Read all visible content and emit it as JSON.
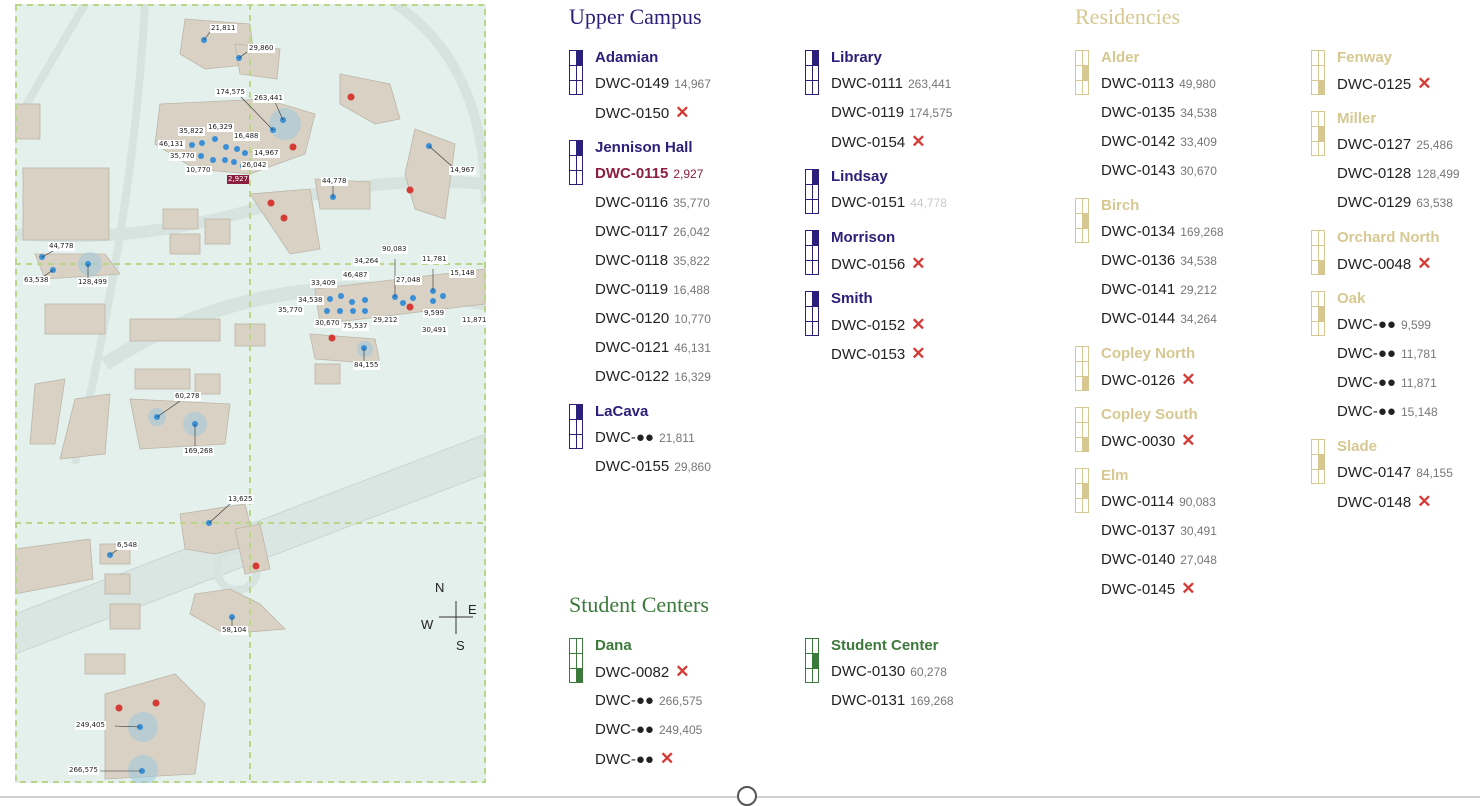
{
  "map": {
    "labels": [
      "21,811",
      "29,860",
      "174,575",
      "263,441",
      "16,329",
      "35,822",
      "16,488",
      "46,131",
      "14,967",
      "35,770",
      "26,042",
      "10,770",
      "2,927",
      "44,778",
      "14,967",
      "44,778",
      "63,538",
      "128,499",
      "90,083",
      "34,264",
      "11,781",
      "15,148",
      "46,487",
      "27,048",
      "33,409",
      "34,538",
      "35,770",
      "30,670",
      "75,537",
      "29,212",
      "9,599",
      "11,871",
      "30,491",
      "84,155",
      "60,278",
      "169,268",
      "13,625",
      "6,548",
      "58,104",
      "249,405",
      "266,575"
    ],
    "compass": {
      "n": "N",
      "e": "E",
      "s": "S",
      "w": "W"
    }
  },
  "colors": {
    "upper": "#2a1f7a",
    "residencies": "#d6c890",
    "student_centers": "#3c7a3b",
    "error": "#d63a35",
    "highlight": "#8b1d3f"
  },
  "sections": {
    "upper": {
      "title": "Upper Campus",
      "col1": [
        {
          "name": "Adamian",
          "level": 0,
          "items": [
            {
              "code": "DWC-0149",
              "count": "14,967"
            },
            {
              "code": "DWC-0150",
              "x": "✕"
            }
          ]
        },
        {
          "name": "Jennison Hall",
          "level": 0,
          "items": [
            {
              "code": "DWC-0115",
              "count": "2,927",
              "highlight": true
            },
            {
              "code": "DWC-0116",
              "count": "35,770"
            },
            {
              "code": "DWC-0117",
              "count": "26,042"
            },
            {
              "code": "DWC-0118",
              "count": "35,822"
            },
            {
              "code": "DWC-0119",
              "count": "16,488"
            },
            {
              "code": "DWC-0120",
              "count": "10,770"
            },
            {
              "code": "DWC-0121",
              "count": "46,131"
            },
            {
              "code": "DWC-0122",
              "count": "16,329"
            }
          ]
        },
        {
          "name": "LaCava",
          "level": 0,
          "items": [
            {
              "code": "DWC-",
              "dots": "●●",
              "count": "21,811"
            },
            {
              "code": "DWC-0155",
              "count": "29,860"
            }
          ]
        }
      ],
      "col2": [
        {
          "name": "Library",
          "level": 0,
          "items": [
            {
              "code": "DWC-0111",
              "count": "263,441"
            },
            {
              "code": "DWC-0119",
              "count": "174,575"
            },
            {
              "code": "DWC-0154",
              "x": "✕"
            }
          ]
        },
        {
          "name": "Lindsay",
          "level": 0,
          "items": [
            {
              "code": "DWC-0151",
              "count": "44,778",
              "faint": true
            }
          ]
        },
        {
          "name": "Morrison",
          "level": 0,
          "items": [
            {
              "code": "DWC-0156",
              "x": "✕"
            }
          ]
        },
        {
          "name": "Smith",
          "level": 0,
          "items": [
            {
              "code": "DWC-0152",
              "x": "✕"
            },
            {
              "code": "DWC-0153",
              "x": "✕"
            }
          ]
        }
      ]
    },
    "residencies": {
      "title": "Residencies",
      "col1": [
        {
          "name": "Alder",
          "level": 1,
          "items": [
            {
              "code": "DWC-0113",
              "count": "49,980"
            },
            {
              "code": "DWC-0135",
              "count": "34,538"
            },
            {
              "code": "DWC-0142",
              "count": "33,409"
            },
            {
              "code": "DWC-0143",
              "count": "30,670"
            }
          ]
        },
        {
          "name": "Birch",
          "level": 1,
          "items": [
            {
              "code": "DWC-0134",
              "count": "169,268"
            },
            {
              "code": "DWC-0136",
              "count": "34,538"
            },
            {
              "code": "DWC-0141",
              "count": "29,212"
            },
            {
              "code": "DWC-0144",
              "count": "34,264"
            }
          ]
        },
        {
          "name": "Copley North",
          "level": 2,
          "items": [
            {
              "code": "DWC-0126",
              "x": "✕"
            }
          ]
        },
        {
          "name": "Copley South",
          "level": 2,
          "items": [
            {
              "code": "DWC-0030",
              "x": "✕"
            }
          ]
        },
        {
          "name": "Elm",
          "level": 1,
          "items": [
            {
              "code": "DWC-0114",
              "count": "90,083"
            },
            {
              "code": "DWC-0137",
              "count": "30,491"
            },
            {
              "code": "DWC-0140",
              "count": "27,048"
            },
            {
              "code": "DWC-0145",
              "x": "✕"
            }
          ]
        }
      ],
      "col2": [
        {
          "name": "Fenway",
          "level": 2,
          "items": [
            {
              "code": "DWC-0125",
              "x": "✕"
            }
          ]
        },
        {
          "name": "Miller",
          "level": 1,
          "items": [
            {
              "code": "DWC-0127",
              "count": "25,486"
            },
            {
              "code": "DWC-0128",
              "count": "128,499"
            },
            {
              "code": "DWC-0129",
              "count": "63,538"
            }
          ]
        },
        {
          "name": "Orchard North",
          "level": 2,
          "items": [
            {
              "code": "DWC-0048",
              "x": "✕"
            }
          ]
        },
        {
          "name": "Oak",
          "level": 1,
          "items": [
            {
              "code": "DWC-",
              "dots": "●●",
              "count": "9,599"
            },
            {
              "code": "DWC-",
              "dots": "●●",
              "count": "11,781"
            },
            {
              "code": "DWC-",
              "dots": "●●",
              "count": "11,871"
            },
            {
              "code": "DWC-",
              "dots": "●●",
              "count": "15,148"
            }
          ]
        },
        {
          "name": "Slade",
          "level": 1,
          "items": [
            {
              "code": "DWC-0147",
              "count": "84,155"
            },
            {
              "code": "DWC-0148",
              "x": "✕"
            }
          ]
        }
      ]
    },
    "student_centers": {
      "title": "Student Centers",
      "col1": [
        {
          "name": "Dana",
          "level": 2,
          "items": [
            {
              "code": "DWC-0082",
              "x": "✕"
            },
            {
              "code": "DWC-",
              "dots": "●●",
              "count": "266,575"
            },
            {
              "code": "DWC-",
              "dots": "●●",
              "count": "249,405"
            },
            {
              "code": "DWC-",
              "dots": "●●",
              "x": "✕"
            }
          ]
        }
      ],
      "col2": [
        {
          "name": "Student Center",
          "level": 1,
          "items": [
            {
              "code": "DWC-0130",
              "count": "60,278"
            },
            {
              "code": "DWC-0131",
              "count": "169,268"
            }
          ]
        }
      ]
    }
  }
}
